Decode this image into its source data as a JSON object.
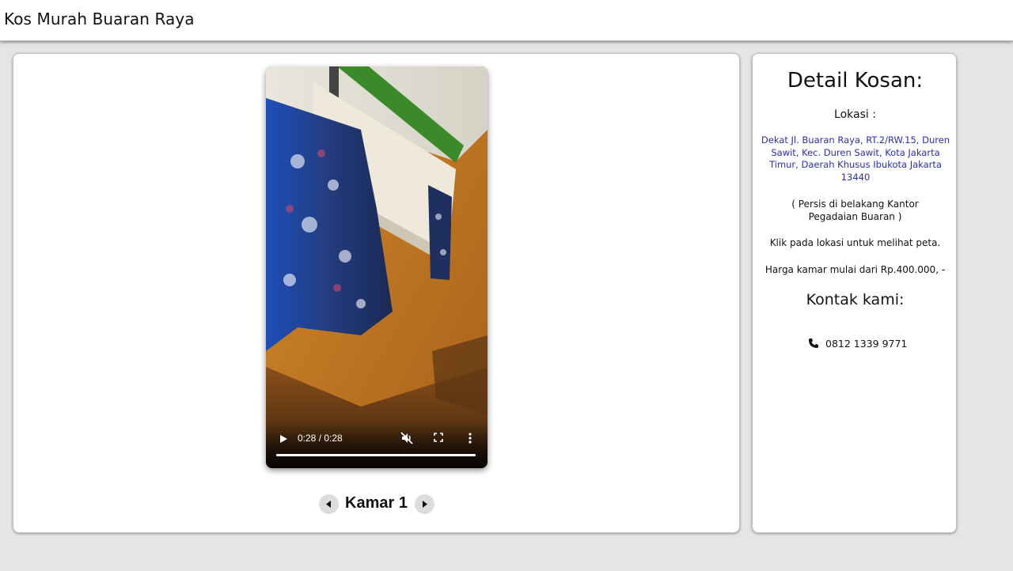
{
  "header": {
    "title": "Kos Murah Buaran Raya"
  },
  "video": {
    "time": "0:28 / 0:28",
    "progress": 1.0,
    "icons": [
      "play-icon",
      "muted-volume-icon",
      "fullscreen-icon",
      "more-vert-icon"
    ]
  },
  "room_nav": {
    "label": "Kamar 1",
    "icons": [
      "chevron-left-icon",
      "chevron-right-icon"
    ]
  },
  "details": {
    "title": "Detail Kosan:",
    "location_label": "Lokasi :",
    "address": "Dekat Jl. Buaran Raya, RT.2/RW.15, Duren Sawit, Kec. Duren Sawit, Kota Jakarta Timur, Daerah Khusus Ibukota Jakarta 13440",
    "note": "( Persis di belakang Kantor Pegadaian Buaran )",
    "map_hint": "Klik pada lokasi untuk melihat peta.",
    "price": "Harga kamar mulai dari Rp.400.000, -",
    "contact_title": "Kontak kami:",
    "phone": "0812 1339 9771"
  },
  "colors": {
    "background": "#e5e5e5",
    "card": "#ffffff",
    "address_link": "#2d2db3"
  }
}
